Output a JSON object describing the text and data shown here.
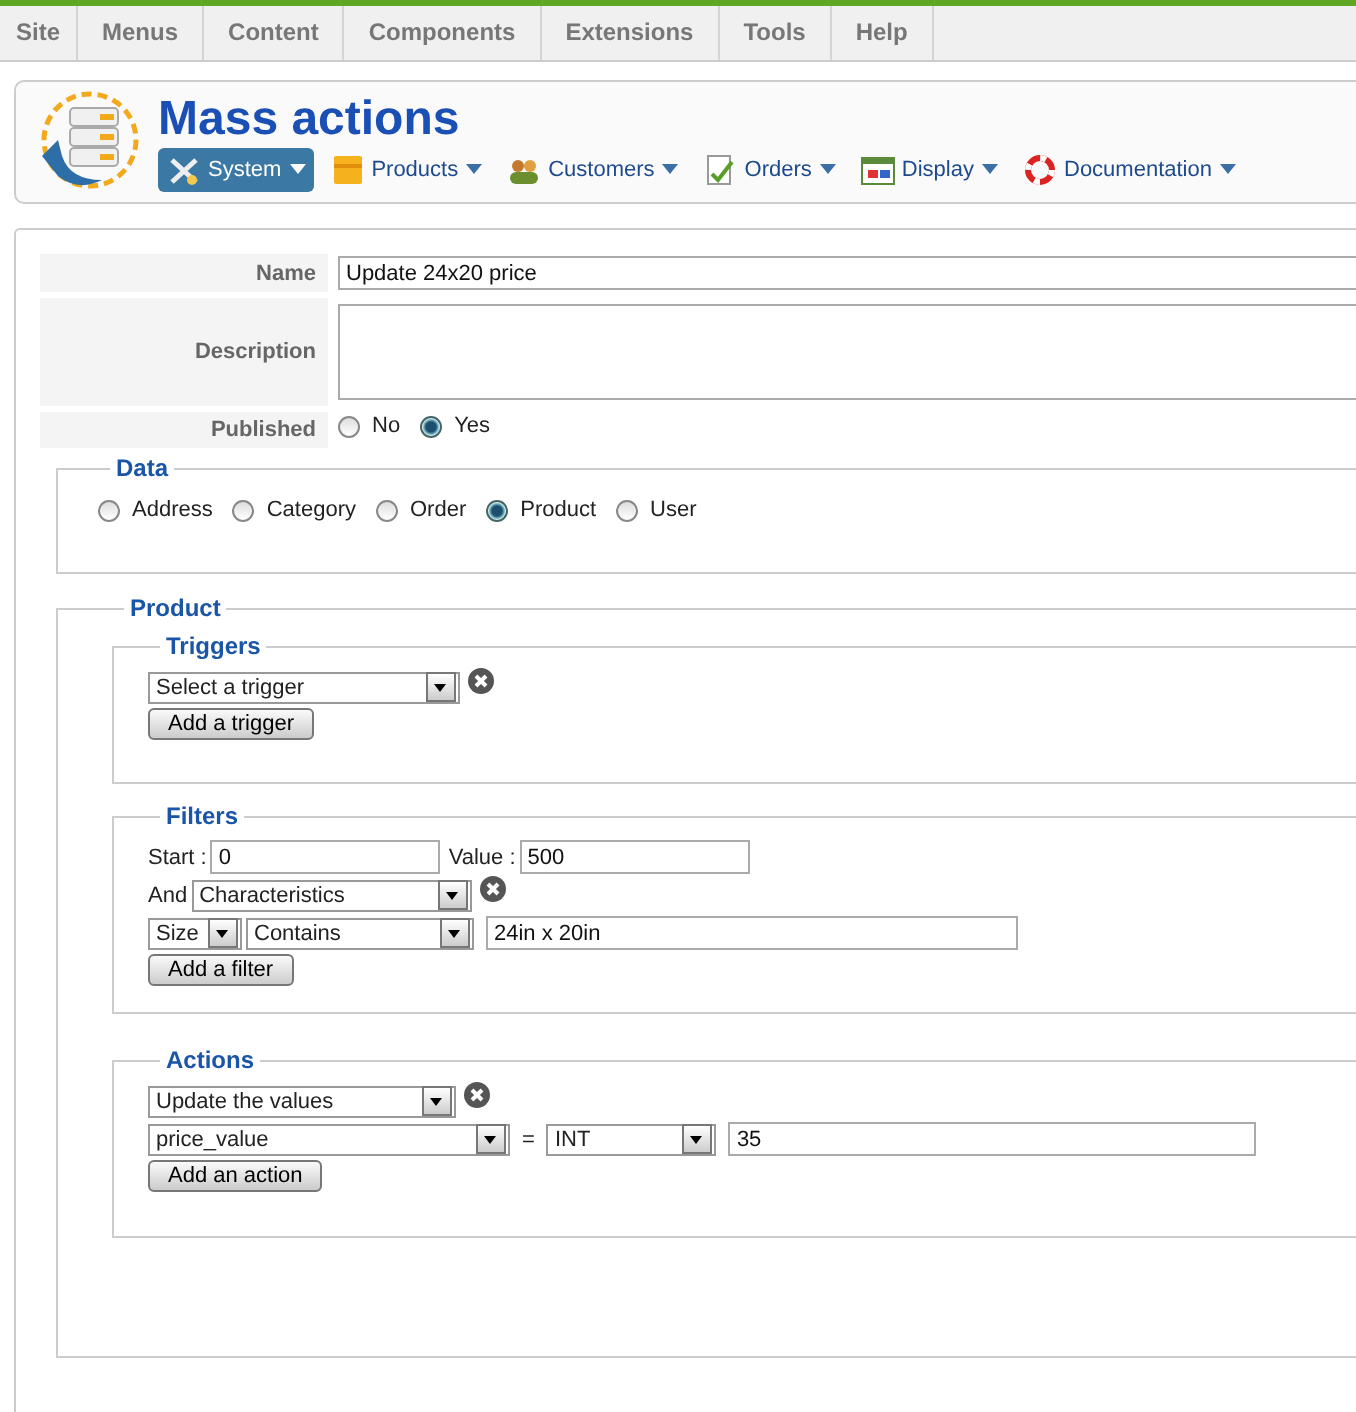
{
  "top_menu": [
    {
      "label": "Site"
    },
    {
      "label": "Menus"
    },
    {
      "label": "Content"
    },
    {
      "label": "Components"
    },
    {
      "label": "Extensions"
    },
    {
      "label": "Tools"
    },
    {
      "label": "Help"
    }
  ],
  "header": {
    "title": "Mass actions",
    "menu": [
      {
        "label": "System",
        "kind": "system",
        "selected": true
      },
      {
        "label": "Products",
        "kind": "products",
        "selected": false
      },
      {
        "label": "Customers",
        "kind": "customers",
        "selected": false
      },
      {
        "label": "Orders",
        "kind": "orders",
        "selected": false
      },
      {
        "label": "Display",
        "kind": "display",
        "selected": false
      },
      {
        "label": "Documentation",
        "kind": "documentation",
        "selected": false
      }
    ]
  },
  "form": {
    "name": {
      "label": "Name",
      "value": "Update 24x20 price"
    },
    "description": {
      "label": "Description"
    },
    "published": {
      "label": "Published",
      "options": [
        {
          "label": "No",
          "selected": false
        },
        {
          "label": "Yes",
          "selected": true
        }
      ]
    }
  },
  "data": {
    "legend": "Data",
    "options": [
      {
        "label": "Address",
        "selected": false
      },
      {
        "label": "Category",
        "selected": false
      },
      {
        "label": "Order",
        "selected": false
      },
      {
        "label": "Product",
        "selected": true
      },
      {
        "label": "User",
        "selected": false
      }
    ]
  },
  "product": {
    "legend": "Product",
    "triggers": {
      "legend": "Triggers",
      "select": "Select a trigger",
      "button": "Add a trigger"
    },
    "filters": {
      "legend": "Filters",
      "start_label": "Start :",
      "start_value": "0",
      "value_label": "Value :",
      "value_value": "500",
      "and_label": "And",
      "type_select": "Characteristics",
      "field_select": "Size",
      "operator_select": "Contains",
      "text_value": "24in x 20in",
      "button": "Add a filter"
    },
    "actions": {
      "legend": "Actions",
      "type_select": "Update the values",
      "field_select": "price_value",
      "equals": "=",
      "kind_select": "INT",
      "value": "35",
      "button": "Add an action"
    }
  }
}
